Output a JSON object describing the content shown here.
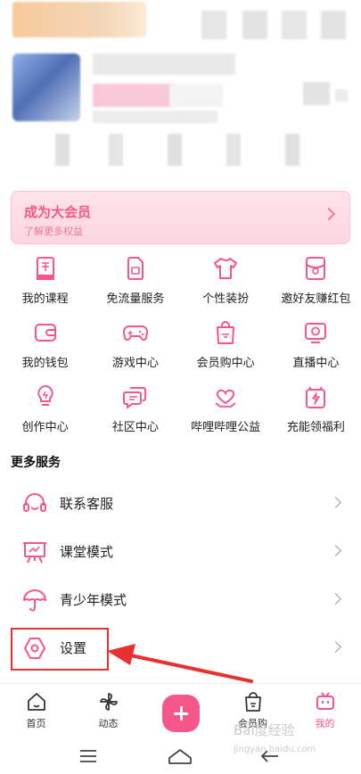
{
  "vip_banner": {
    "title": "成为大会员",
    "subtitle": "了解更多权益"
  },
  "grid": [
    [
      {
        "label": "我的课程",
        "icon": "course-icon"
      },
      {
        "label": "免流量服务",
        "icon": "sim-card-icon"
      },
      {
        "label": "个性装扮",
        "icon": "tshirt-icon"
      },
      {
        "label": "邀好友赚红包",
        "icon": "red-envelope-icon"
      }
    ],
    [
      {
        "label": "我的钱包",
        "icon": "wallet-icon"
      },
      {
        "label": "游戏中心",
        "icon": "gamepad-icon"
      },
      {
        "label": "会员购中心",
        "icon": "shopping-bag-icon"
      },
      {
        "label": "直播中心",
        "icon": "live-tv-icon"
      }
    ],
    [
      {
        "label": "创作中心",
        "icon": "lightbulb-icon"
      },
      {
        "label": "社区中心",
        "icon": "chat-bubbles-icon"
      },
      {
        "label": "哔哩哔哩公益",
        "icon": "heart-hands-icon"
      },
      {
        "label": "充能领福利",
        "icon": "charge-gift-icon"
      }
    ]
  ],
  "more_services": {
    "title": "更多服务",
    "items": [
      {
        "label": "联系客服",
        "icon": "headset-icon"
      },
      {
        "label": "课堂模式",
        "icon": "classroom-icon"
      },
      {
        "label": "青少年模式",
        "icon": "umbrella-icon"
      },
      {
        "label": "设置",
        "icon": "settings-hexagon-icon"
      }
    ]
  },
  "bottom_nav": [
    {
      "label": "首页",
      "icon": "home-icon"
    },
    {
      "label": "动态",
      "icon": "pinwheel-icon"
    },
    {
      "label": "",
      "icon": "plus-icon"
    },
    {
      "label": "会员购",
      "icon": "shopping-bag-icon"
    },
    {
      "label": "我的",
      "icon": "tv-icon",
      "active": true
    }
  ],
  "watermark": {
    "text": "Bai度经验",
    "sub": "jingyan.baidu.com"
  },
  "colors": {
    "accent": "#f5578a",
    "highlight": "#e83030"
  }
}
